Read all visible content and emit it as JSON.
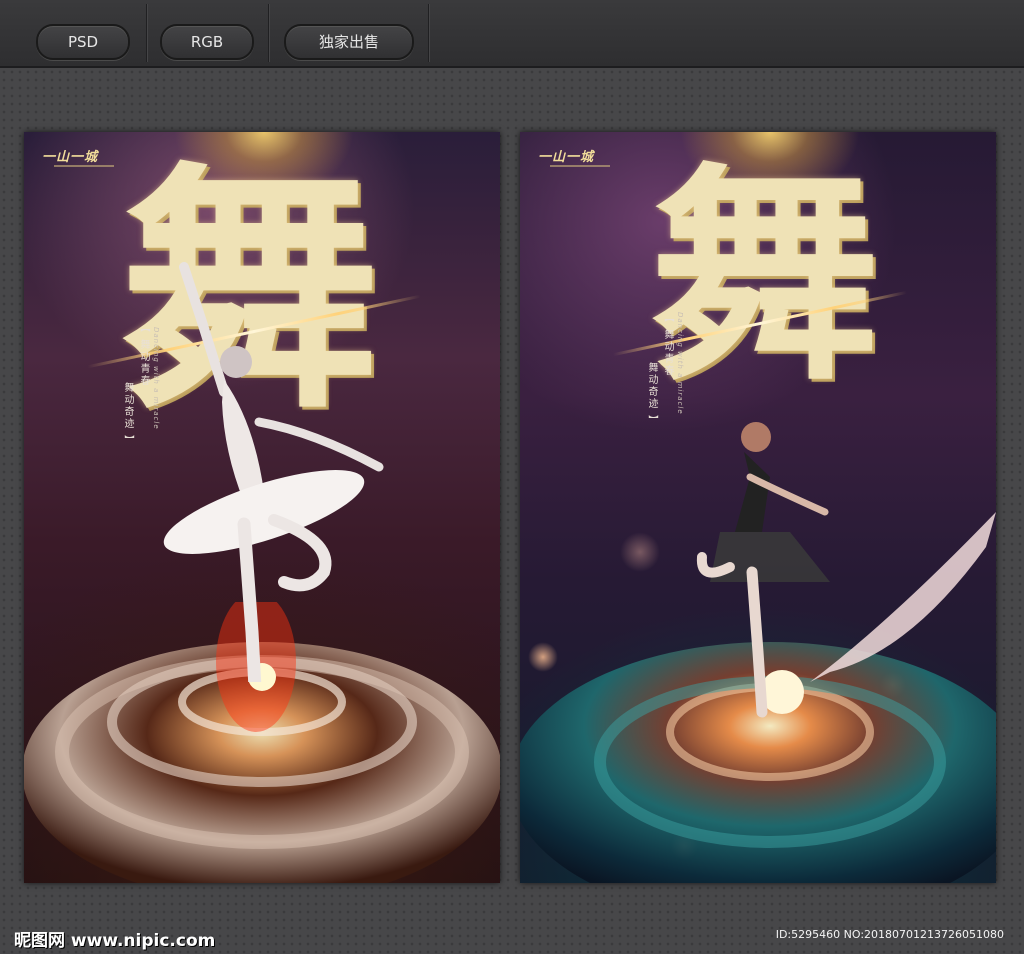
{
  "toolbar": {
    "buttons": [
      {
        "label": "PSD"
      },
      {
        "label": "RGB"
      },
      {
        "label": "独家出售"
      }
    ]
  },
  "posters": [
    {
      "brand": "一山一城",
      "title_char": "舞",
      "tagline_cn": [
        "【 舞动青春",
        "舞动奇迹 】"
      ],
      "tagline_en": "Dancing with a miracle",
      "palette": "purple-brown"
    },
    {
      "brand": "一山一城",
      "title_char": "舞",
      "tagline_cn": [
        "【 舞动青春",
        "舞动奇迹 】"
      ],
      "tagline_en": "Dancing with a miracle",
      "palette": "purple-teal"
    }
  ],
  "footer": {
    "logo": "昵图网 www.nipic.com",
    "id_text": "ID:5295460 NO:20180701213726051080"
  },
  "icons": [
    "ballerina-figure",
    "fractal-flower",
    "silk-ribbon"
  ],
  "colors": {
    "gold": "#efe2b6",
    "toolbar": "#3a3a3c",
    "background": "#474749"
  }
}
